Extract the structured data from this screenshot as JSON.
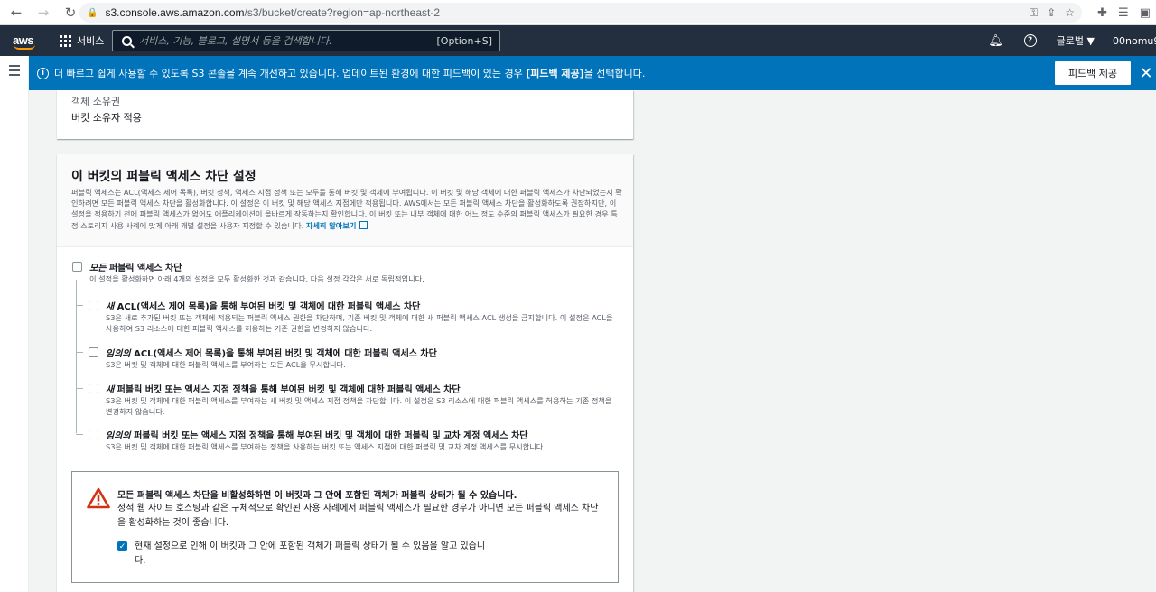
{
  "browser": {
    "url_domain": "s3.console.aws.amazon.com",
    "url_path": "/s3/bucket/create?region=ap-northeast-2"
  },
  "awsnav": {
    "logo": "aws",
    "services_label": "서비스",
    "search_placeholder": "서비스, 기능, 블로그, 설명서 등을 검색합니다.",
    "search_shortcut": "[Option+S]",
    "region_label": "글로벌 ▼",
    "user_label": "00nomu9"
  },
  "banner": {
    "message_prefix": "더 빠르고 쉽게 사용할 수 있도록 S3 콘솔을 계속 개선하고 있습니다. 업데이트된 환경에 대한 피드백이 있는 경우 ",
    "message_bold": "[피드백 제공]",
    "message_suffix": "을 선택합니다.",
    "feedback_button": "피드백 제공"
  },
  "ownership": {
    "label": "객체 소유권",
    "value": "버킷 소유자 적용"
  },
  "block_public": {
    "title": "이 버킷의 퍼블릭 액세스 차단 설정",
    "description": "퍼블릭 액세스는 ACL(액세스 제어 목록), 버킷 정책, 액세스 지점 정책 또는 모두를 통해 버킷 및 객체에 부여됩니다. 이 버킷 및 해당 객체에 대한 퍼블릭 액세스가 차단되었는지 확인하려면 모든 퍼블릭 액세스 차단을 활성화합니다. 이 설정은 이 버킷 및 해당 액세스 지점에만 적용됩니다. AWS에서는 모든 퍼블릭 액세스 차단을 활성화하도록 권장하지만, 이 설정을 적용하기 전에 퍼블릭 액세스가 없어도 애플리케이션이 올바르게 작동하는지 확인합니다. 이 버킷 또는 내부 객체에 대한 어느 정도 수준의 퍼블릭 액세스가 필요한 경우 특정 스토리지 사용 사례에 맞게 아래 개별 설정을 사용자 지정할 수 있습니다.",
    "learn_more": "자세히 알아보기",
    "all": {
      "title_em": "모든",
      "title_rest": " 퍼블릭 액세스 차단",
      "desc": "이 설정을 활성화하면 아래 4개의 설정을 모두 활성화한 것과 같습니다. 다음 설정 각각은 서로 독립적입니다."
    },
    "options": [
      {
        "title_em": "새",
        "title_rest": " ACL(액세스 제어 목록)을 통해 부여된 버킷 및 객체에 대한 퍼블릭 액세스 차단",
        "desc": "S3은 새로 추가된 버킷 또는 객체에 적용되는 퍼블릭 액세스 권한을 차단하며, 기존 버킷 및 객체에 대한 새 퍼블릭 액세스 ACL 생성을 금지합니다. 이 설정은 ACL을 사용하여 S3 리소스에 대한 퍼블릭 액세스를 허용하는 기존 권한을 변경하지 않습니다."
      },
      {
        "title_em": "임의의",
        "title_rest": " ACL(액세스 제어 목록)을 통해 부여된 버킷 및 객체에 대한 퍼블릭 액세스 차단",
        "desc": "S3은 버킷 및 객체에 대한 퍼블릭 액세스를 부여하는 모든 ACL을 무시합니다."
      },
      {
        "title_em": "새",
        "title_rest": " 퍼블릭 버킷 또는 액세스 지점 정책을 통해 부여된 버킷 및 객체에 대한 퍼블릭 액세스 차단",
        "desc": "S3은 버킷 및 객체에 대한 퍼블릭 액세스를 부여하는 새 버킷 및 액세스 지점 정책을 차단합니다. 이 설정은 S3 리소스에 대한 퍼블릭 액세스를 허용하는 기존 정책을 변경하지 않습니다."
      },
      {
        "title_em": "임의의",
        "title_rest": " 퍼블릭 버킷 또는 액세스 지점 정책을 통해 부여된 버킷 및 객체에 대한 퍼블릭 및 교차 계정 액세스 차단",
        "desc": "S3은 버킷 및 객체에 대한 퍼블릭 액세스를 부여하는 정책을 사용하는 버킷 또는 액세스 지점에 대한 퍼블릭 및 교차 계정 액세스를 무시합니다."
      }
    ]
  },
  "warning": {
    "title": "모든 퍼블릭 액세스 차단을 비활성화하면 이 버킷과 그 안에 포함된 객체가 퍼블릭 상태가 될 수 있습니다.",
    "body": "정적 웹 사이트 호스팅과 같은 구체적으로 확인된 사용 사례에서 퍼블릭 액세스가 필요한 경우가 아니면 모든 퍼블릭 액세스 차단을 활성화하는 것이 좋습니다.",
    "ack": "현재 설정으로 인해 이 버킷과 그 안에 포함된 객체가 퍼블릭 상태가 될 수 있음을 알고 있습니다."
  },
  "colors": {
    "aws_nav": "#232f3e",
    "banner": "#0073bb",
    "warning_red": "#d13212",
    "link": "#0073bb"
  }
}
